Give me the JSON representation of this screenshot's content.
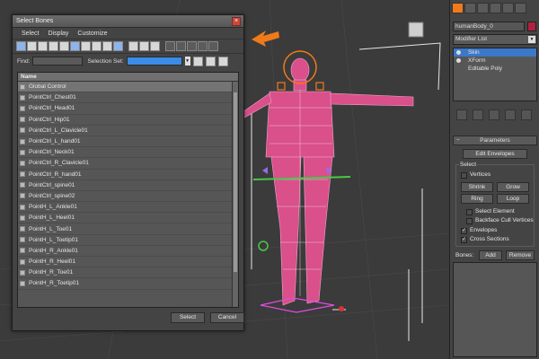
{
  "dialog": {
    "title": "Select Bones",
    "close_glyph": "×",
    "menus": [
      "Select",
      "Display",
      "Customize"
    ],
    "find_label": "Find:",
    "selection_set_label": "Selection Set:",
    "column_name": "Name",
    "bones": [
      "Global Control",
      "PointCtrl_Chest01",
      "PointCtrl_Head01",
      "PointCtrl_Hip01",
      "PointCtrl_L_Clavicle01",
      "PointCtrl_L_hand01",
      "PointCtrl_Neck01",
      "PointCtrl_R_Clavicle01",
      "PointCtrl_R_hand01",
      "PointCtrl_spine01",
      "PointCtrl_spine02",
      "PointH_L_Ankle01",
      "PointH_L_Heel01",
      "PointH_L_Toe01",
      "PointH_L_Toetip01",
      "PointH_R_Ankle01",
      "PointH_R_Heel01",
      "PointH_R_Toe01",
      "PointH_R_Toetip01"
    ],
    "select_label": "Select",
    "cancel_label": "Cancel"
  },
  "panel": {
    "object_name": "humanBody_0",
    "modifier_list": "Modifier List",
    "stack": [
      "Skin",
      "XForm",
      "Editable Poly"
    ],
    "rollout_title": "Parameters",
    "edit_envelopes": "Edit Envelopes",
    "select_group": "Select",
    "vertices": "Vertices",
    "shrink": "Shrink",
    "grow": "Grow",
    "ring": "Ring",
    "loop": "Loop",
    "select_element": "Select Element",
    "backface_cull": "Backface Cull Vertices",
    "envelopes": "Envelopes",
    "cross_sections": "Cross Sections",
    "bones_label": "Bones:",
    "add": "Add",
    "remove": "Remove"
  },
  "colors": {
    "accent_orange": "#f07a1a",
    "selection_blue": "#3b78c8",
    "mesh_pink": "#e0508a"
  }
}
